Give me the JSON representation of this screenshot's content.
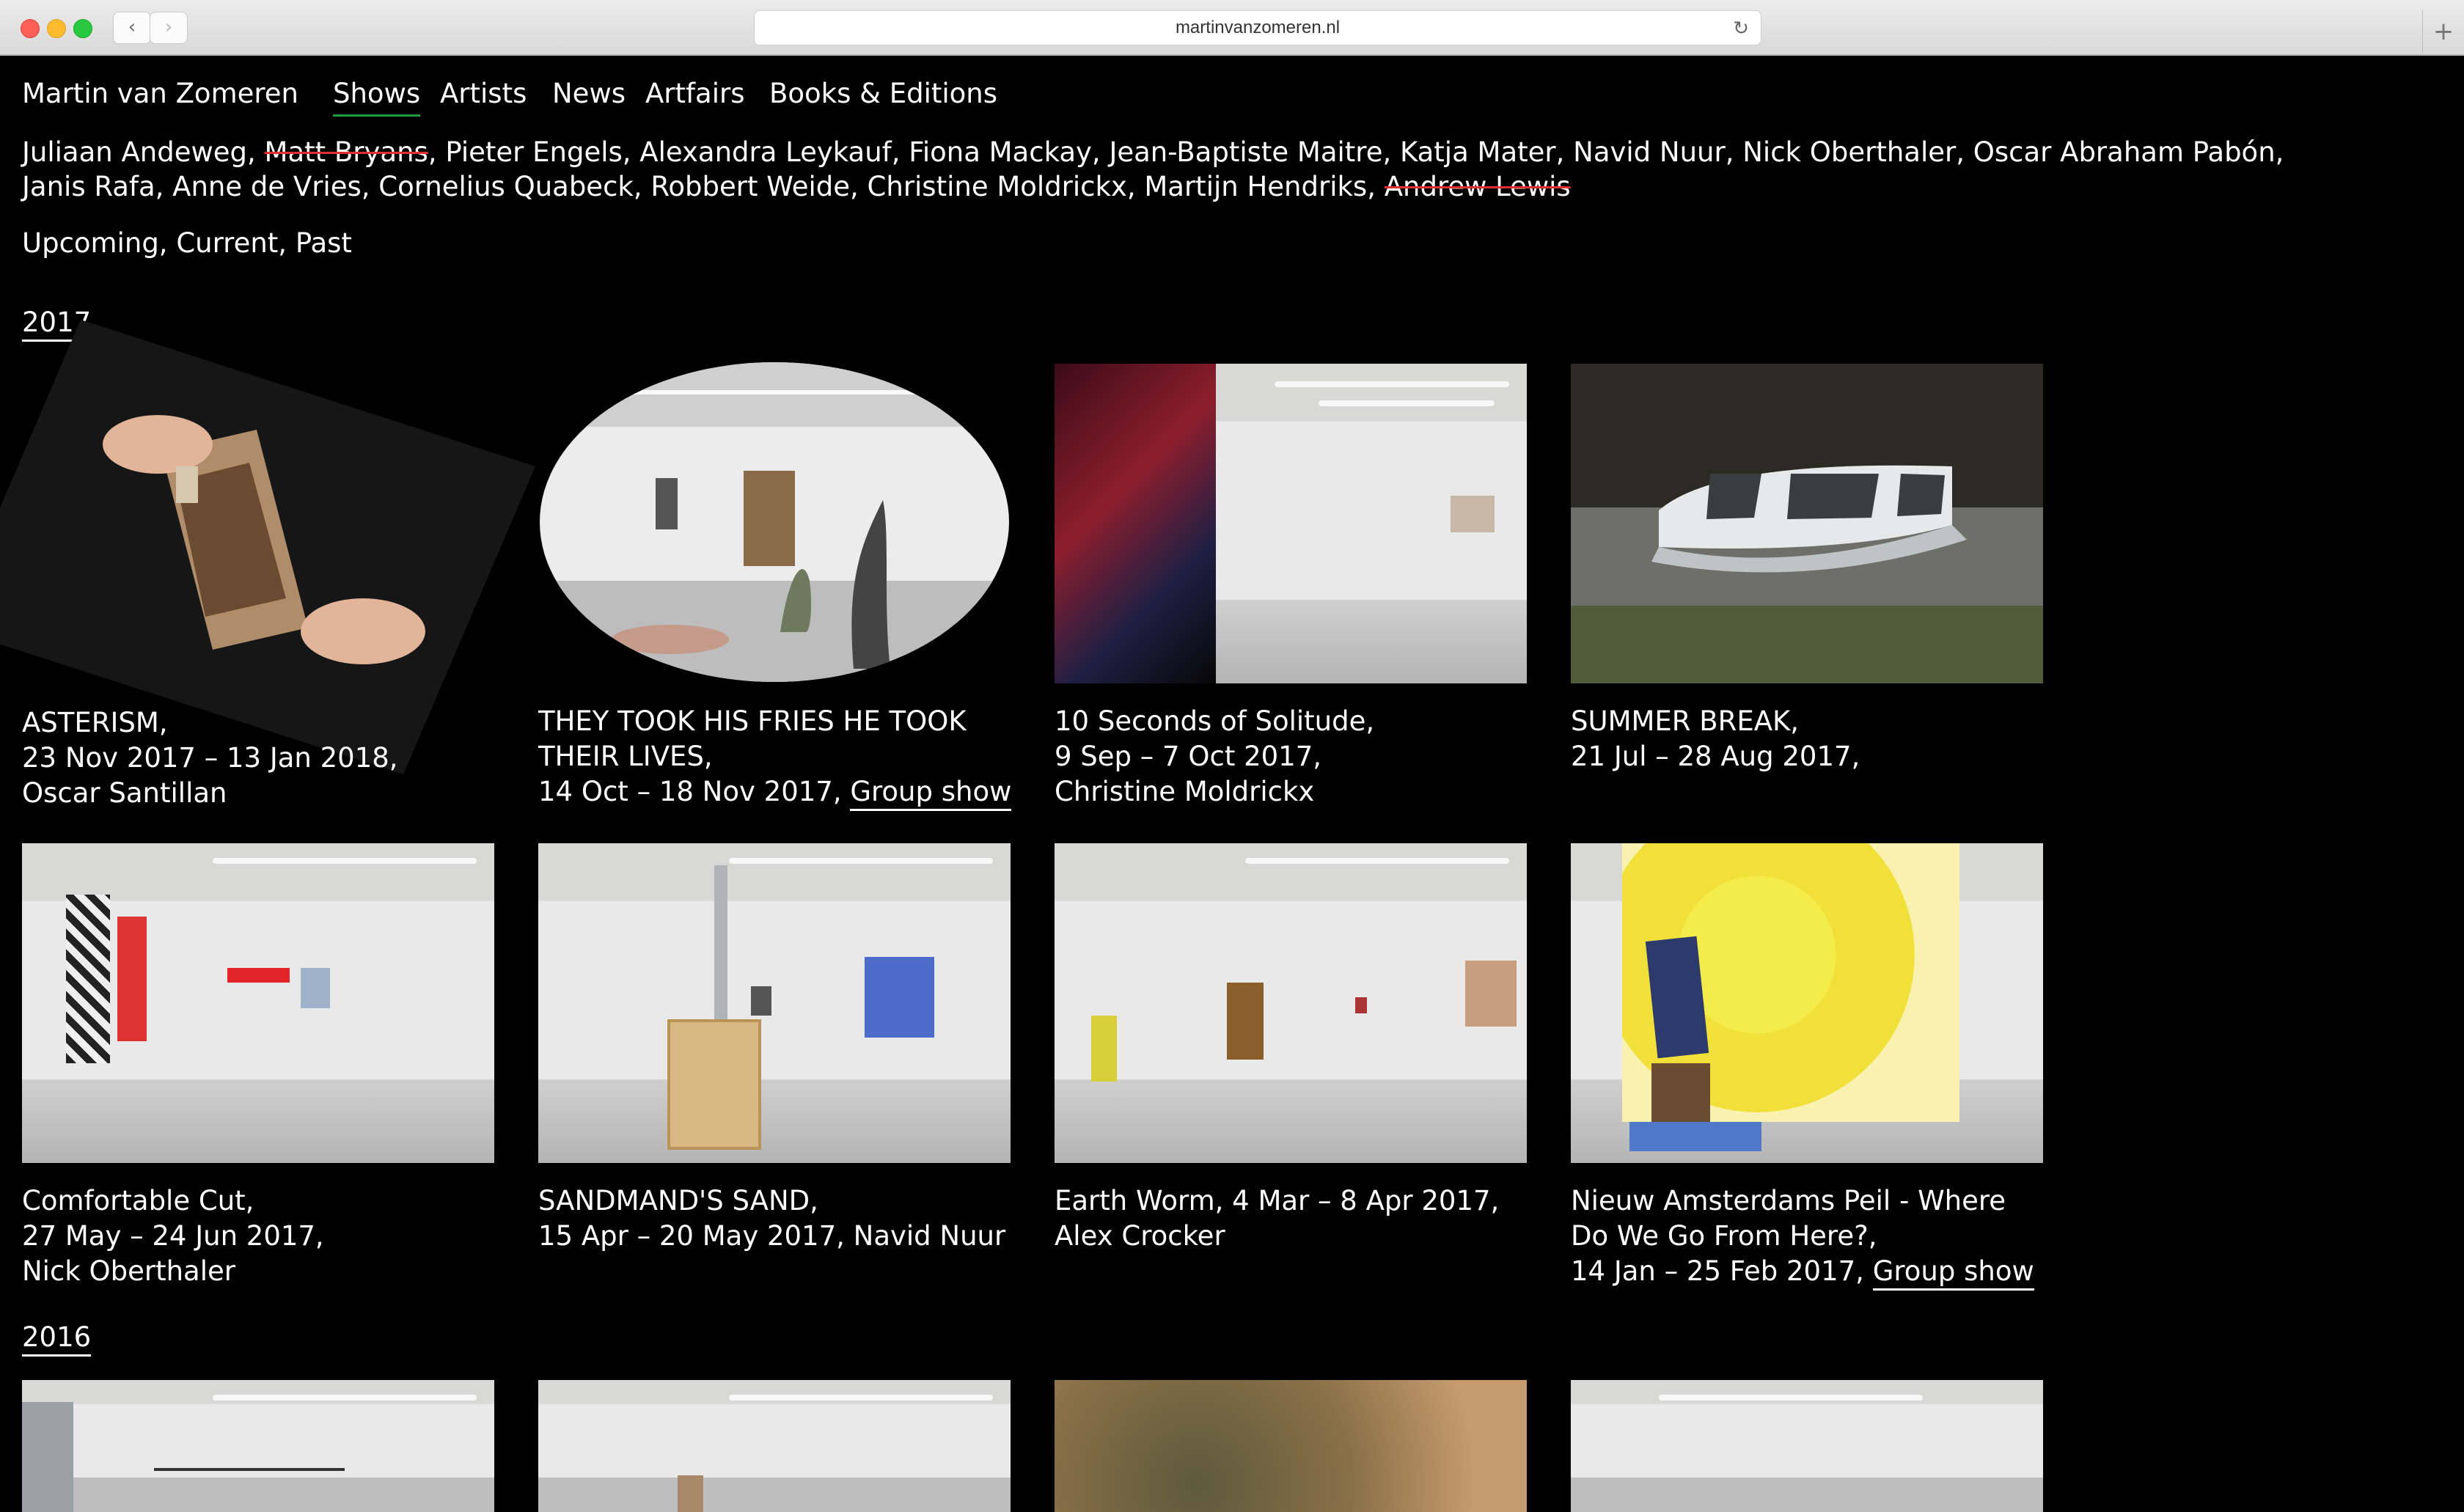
{
  "browser": {
    "url": "martinvanzomeren.nl",
    "back_icon": "‹",
    "forward_icon": "›",
    "reload_icon": "↻",
    "new_tab_icon": "+"
  },
  "site": {
    "title": "Martin van Zomeren",
    "nav": [
      "Shows",
      "Artists",
      "News",
      "Artfairs",
      "Books & Editions"
    ],
    "active_nav": "Shows",
    "accent_color": "#1f9b3a"
  },
  "artists": {
    "line1": [
      {
        "name": "Juliaan Andeweg",
        "struck": false
      },
      {
        "name": "Matt Bryans",
        "struck": true
      },
      {
        "name": "Pieter Engels",
        "struck": false
      },
      {
        "name": "Alexandra Leykauf",
        "struck": false
      },
      {
        "name": "Fiona Mackay",
        "struck": false
      },
      {
        "name": "Jean-Baptiste Maitre",
        "struck": false
      },
      {
        "name": "Katja Mater",
        "struck": false
      },
      {
        "name": "Navid Nuur",
        "struck": false
      },
      {
        "name": "Nick Oberthaler",
        "struck": false
      },
      {
        "name": "Oscar Abraham Pabón",
        "struck": false
      }
    ],
    "line2": [
      {
        "name": "Janis Rafa",
        "struck": false
      },
      {
        "name": "Anne de Vries",
        "struck": false
      },
      {
        "name": "Cornelius Quabeck",
        "struck": false
      },
      {
        "name": "Robbert Weide",
        "struck": false
      },
      {
        "name": "Christine Moldrickx",
        "struck": false
      },
      {
        "name": "Martijn Hendriks",
        "struck": false
      },
      {
        "name": "Andrew Lewis",
        "struck": true
      }
    ]
  },
  "filters": "Upcoming, Current, Past",
  "years": [
    "2017",
    "2016"
  ],
  "shows": [
    {
      "lines": [
        "ASTERISM,",
        "23 Nov 2017 – 13 Jan 2018,",
        "Oscar Santillan"
      ],
      "link": ""
    },
    {
      "lines": [
        "THEY TOOK HIS FRIES HE TOOK",
        "THEIR LIVES,",
        "14 Oct – 18 Nov 2017, "
      ],
      "link": "Group show"
    },
    {
      "lines": [
        "10 Seconds of Solitude,",
        "9 Sep – 7 Oct 2017,",
        "Christine Moldrickx"
      ],
      "link": ""
    },
    {
      "lines": [
        "SUMMER BREAK,",
        "21 Jul – 28 Aug 2017,"
      ],
      "link": ""
    },
    {
      "lines": [
        "Comfortable Cut,",
        "27 May – 24 Jun 2017,",
        "Nick Oberthaler"
      ],
      "link": ""
    },
    {
      "lines": [
        "SANDMAND'S SAND,",
        "15 Apr – 20 May 2017, Navid Nuur"
      ],
      "link": ""
    },
    {
      "lines": [
        "Earth Worm, 4 Mar – 8 Apr 2017,",
        "Alex Crocker"
      ],
      "link": ""
    },
    {
      "lines": [
        "Nieuw Amsterdams Peil - Where",
        "Do We Go From Here?,",
        "14 Jan – 25 Feb 2017, "
      ],
      "link": "Group show"
    }
  ]
}
